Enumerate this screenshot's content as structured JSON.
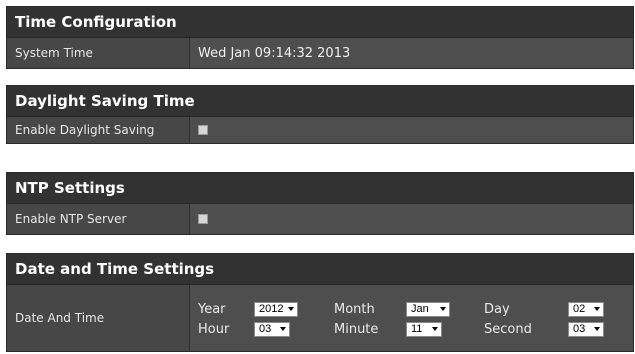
{
  "time_config": {
    "title": "Time Configuration",
    "system_time_label": "System Time",
    "system_time_value": "Wed Jan 09:14:32 2013"
  },
  "dst": {
    "title": "Daylight Saving Time",
    "enable_label": "Enable Daylight Saving",
    "enabled": false
  },
  "ntp": {
    "title": "NTP Settings",
    "enable_label": "Enable NTP Server",
    "enabled": false
  },
  "datetime": {
    "title": "Date and Time Settings",
    "row_label": "Date And Time",
    "fields": {
      "year": {
        "label": "Year",
        "value": "2012"
      },
      "month": {
        "label": "Month",
        "value": "Jan"
      },
      "day": {
        "label": "Day",
        "value": "02"
      },
      "hour": {
        "label": "Hour",
        "value": "03"
      },
      "minute": {
        "label": "Minute",
        "value": "11"
      },
      "second": {
        "label": "Second",
        "value": "03"
      }
    }
  }
}
